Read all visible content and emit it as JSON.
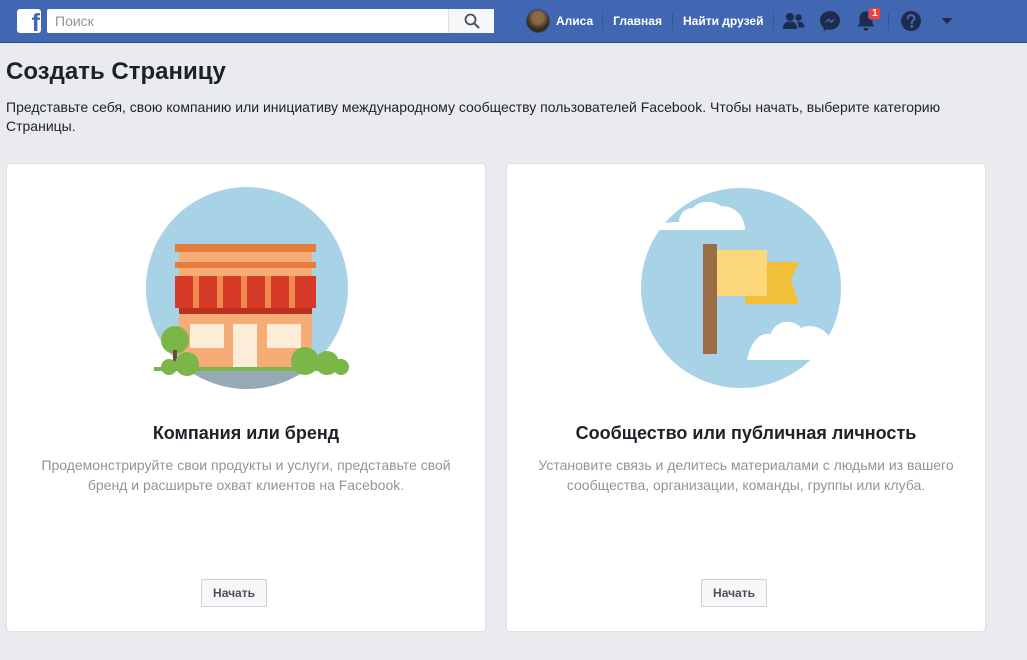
{
  "topbar": {
    "logo_letter": "f",
    "search": {
      "placeholder": "Поиск",
      "value": ""
    },
    "user_name": "Алиса",
    "links": {
      "home": "Главная",
      "find_friends": "Найти друзей"
    },
    "notifications_count": "1"
  },
  "page": {
    "title": "Создать Страницу",
    "description": "Представьте себя, свою компанию или инициативу международному сообществу пользователей Facebook. Чтобы начать, выберите категорию Страницы."
  },
  "cards": [
    {
      "title": "Компания или бренд",
      "description": "Продемонстрируйте свои продукты и услуги, представьте свой бренд и расширьте охват клиентов на Facebook.",
      "button": "Начать",
      "icon": "storefront-illustration"
    },
    {
      "title": "Сообщество или публичная личность",
      "description": "Установите связь и делитесь материалами с людьми из вашего сообщества, организации, команды, группы или клуба.",
      "button": "Начать",
      "icon": "flag-illustration"
    }
  ],
  "colors": {
    "topbar": "#4267b2",
    "background": "#e9ebee",
    "illustration_circle": "#a8d3e6"
  }
}
